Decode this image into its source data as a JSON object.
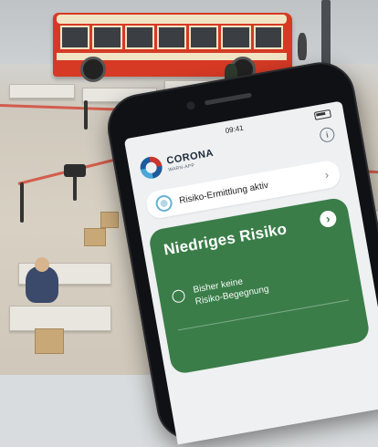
{
  "phone": {
    "status_time": "09:41",
    "app": {
      "brand_title": "CORONA",
      "brand_subtitle": "WARN-APP",
      "info_icon": "info-icon",
      "tracing_label": "Risiko-Ermittlung aktiv",
      "tracing_icon": "tracing-signal-icon",
      "tracing_chevron": "›",
      "risk_card": {
        "title": "Niedriges Risiko",
        "chevron": "›",
        "color": "#3a7d48",
        "row_text": "Bisher keine\nRisiko-Begegnung",
        "row_icon": "check-circle-icon"
      }
    }
  }
}
